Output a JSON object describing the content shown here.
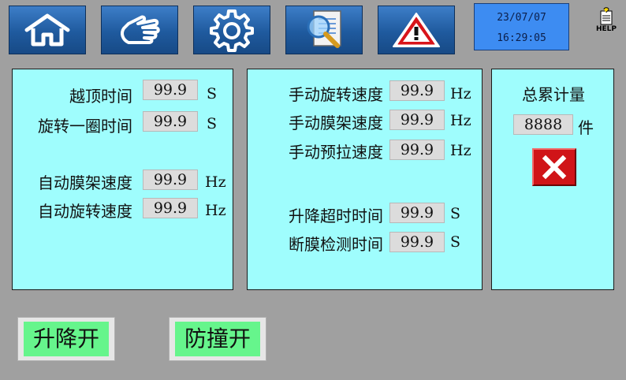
{
  "toolbar": {
    "home_icon": "home-icon",
    "hand_icon": "hand-pointer-icon",
    "gear_icon": "gear-icon",
    "search_icon": "document-search-icon",
    "warning_icon": "warning-icon"
  },
  "clock": {
    "date": "23/07/07",
    "time": "16:29:05"
  },
  "help": {
    "label": "HELP"
  },
  "panel_left": {
    "rows": [
      {
        "label": "越顶时间",
        "value": "99.9",
        "unit": "S"
      },
      {
        "label": "旋转一圈时间",
        "value": "99.9",
        "unit": "S"
      },
      {
        "label": "自动膜架速度",
        "value": "99.9",
        "unit": "Hz"
      },
      {
        "label": "自动旋转速度",
        "value": "99.9",
        "unit": "Hz"
      }
    ]
  },
  "panel_middle": {
    "rows": [
      {
        "label": "手动旋转速度",
        "value": "99.9",
        "unit": "Hz"
      },
      {
        "label": "手动膜架速度",
        "value": "99.9",
        "unit": "Hz"
      },
      {
        "label": "手动预拉速度",
        "value": "99.9",
        "unit": "Hz"
      },
      {
        "label": "升降超时时间",
        "value": "99.9",
        "unit": "S"
      },
      {
        "label": "断膜检测时间",
        "value": "99.9",
        "unit": "S"
      }
    ]
  },
  "panel_right": {
    "title": "总累计量",
    "count": "8888",
    "unit": "件",
    "reset_icon": "close-x-icon"
  },
  "bottom": {
    "lift_label": "升降开",
    "anticollision_label": "防撞开"
  },
  "colors": {
    "background": "#a0a0a0",
    "panel": "#9ffdfd",
    "toolbar_blue": "#1f5a9e",
    "clock": "#3d8cf2",
    "reset_red": "#d01418",
    "toggle_green": "#66f58c"
  }
}
